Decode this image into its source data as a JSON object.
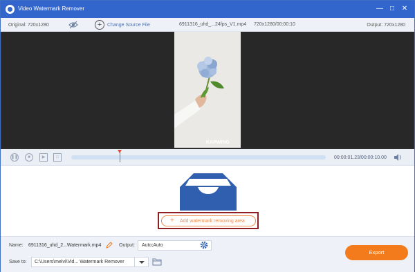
{
  "window": {
    "title": "Video Watermark Remover",
    "minimize_icon": "minimize-icon",
    "maximize_icon": "maximize-icon",
    "close_icon": "close-icon"
  },
  "infobar": {
    "original": "Original: 720x1280",
    "change_source": "Change Source File",
    "file_name": "6911316_uhd_...24fps_V1.mp4",
    "file_meta": "720x1280/00:00:10",
    "output": "Output: 720x1280"
  },
  "preview": {
    "watermark": "KAPWING"
  },
  "timeline": {
    "time": "00:00:01.23/00:00:10.00",
    "playhead_fraction": 0.19
  },
  "main": {
    "add_area_label": "Add watermark removing area"
  },
  "bottom": {
    "name_label": "Name:",
    "name_value": "6911316_uhd_2...Watermark.mp4",
    "output_label": "Output:",
    "output_value": "Auto;Auto",
    "save_label": "Save to:",
    "save_path": "C:\\Users\\melvi\\Vid... Watermark Remover",
    "export_label": "Export"
  },
  "colors": {
    "title_bar": "#3366cc",
    "accent_orange": "#f47b1b",
    "highlight_frame": "#8f1e23",
    "tray_blue": "#2f5fae"
  }
}
